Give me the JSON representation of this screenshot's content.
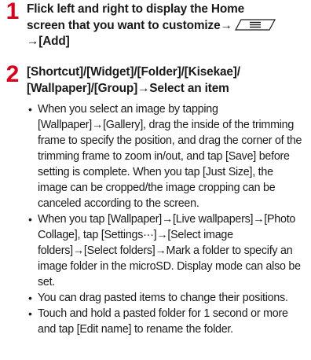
{
  "accent_color": "#d6001c",
  "steps": [
    {
      "number": "1",
      "line1": "Flick left and right to display the Home",
      "line2a": "screen that you want to customize→",
      "line3": "→[Add]",
      "key_icon": "menu-key-icon"
    },
    {
      "number": "2",
      "line1": "[Shortcut]/[Widget]/[Folder]/[Kisekae]/",
      "line2": "[Wallpaper]/[Group]→Select an item"
    }
  ],
  "bullets": [
    "When you select an image by tapping [Wallpaper]→[Gallery], drag the inside of the trimming frame to specify the position, and drag the corner of the trimming frame to zoom in/out, and tap [Save] before setting is complete. When you tap [Just Size], the image can be cropped/the image cropping can be canceled according to the screen.",
    "When you tap [Wallpaper]→[Live wallpapers]→[Photo Collage], tap [Settings···]→[Select image folders]→[Select folders]→Mark a folder to specify an image folder in the microSD. Display mode can also be set.",
    "You can drag pasted items to change their positions.",
    "Touch and hold a pasted folder for 1 second or more and tap [Edit name] to rename the folder."
  ],
  "bullet_symbol": "•"
}
